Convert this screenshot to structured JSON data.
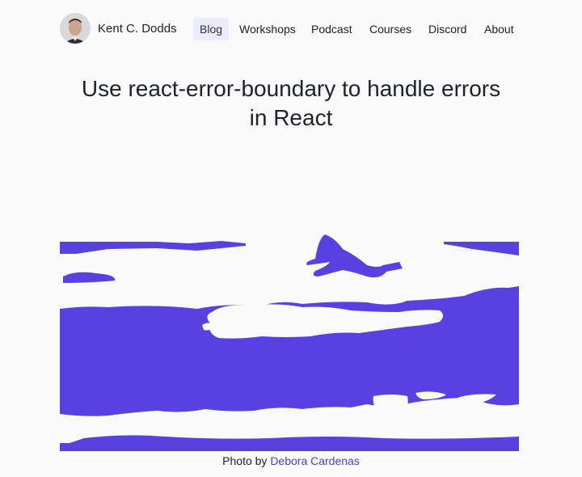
{
  "header": {
    "site_name": "Kent C. Dodds",
    "nav": [
      {
        "label": "Blog",
        "active": true
      },
      {
        "label": "Workshops",
        "active": false
      },
      {
        "label": "Podcast",
        "active": false
      },
      {
        "label": "Courses",
        "active": false
      },
      {
        "label": "Discord",
        "active": false
      },
      {
        "label": "About",
        "active": false
      }
    ]
  },
  "article": {
    "title_line1": "Use react-error-boundary to handle errors",
    "title_line2": "in React"
  },
  "hero": {
    "caption_prefix": "Photo by ",
    "caption_author": "Debora Cardenas"
  },
  "colors": {
    "accent": "#5741e0",
    "nav_active_bg": "#ecebfd",
    "background": "#fafafa"
  }
}
